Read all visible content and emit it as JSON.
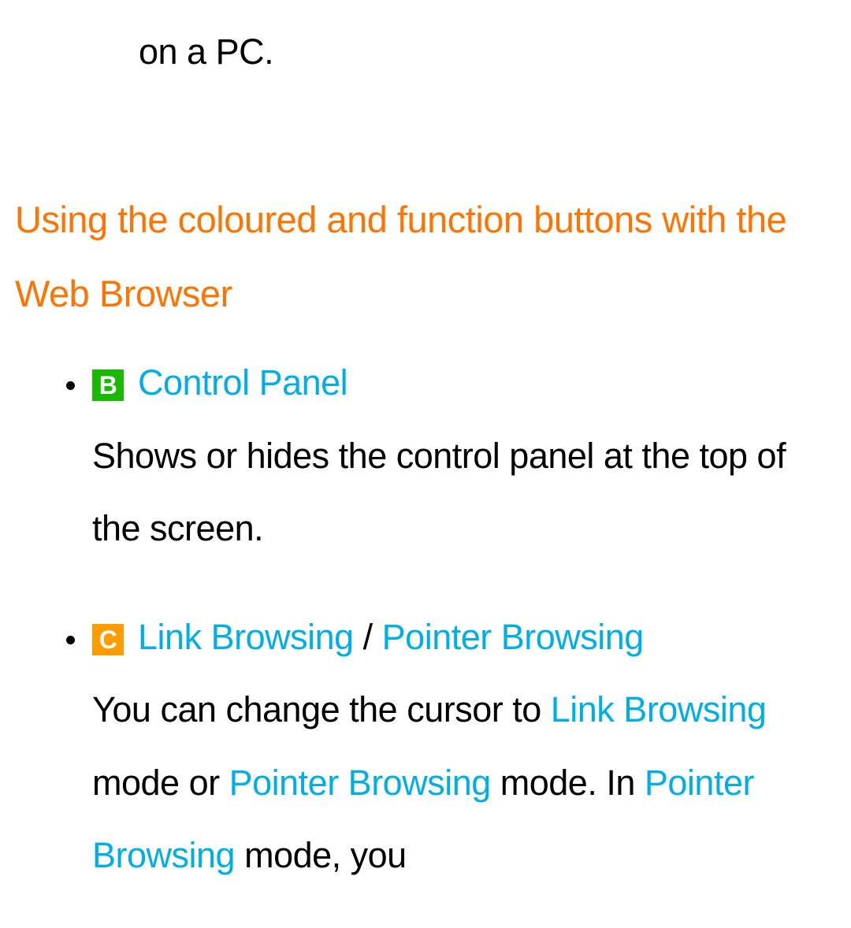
{
  "fragment_text": "on a PC.",
  "section_heading": "Using the coloured and function buttons with the Web Browser",
  "items": [
    {
      "badge_letter": "B",
      "title": "Control Panel",
      "desc": "Shows or hides the control panel at the top of the screen."
    },
    {
      "badge_letter": "C",
      "title_a": "Link Browsing",
      "slash": " / ",
      "title_b": "Pointer Browsing",
      "desc_parts": {
        "p1": "You can change the cursor to ",
        "t1": "Link Browsing",
        "p2": " mode or ",
        "t2": "Pointer Browsing",
        "p3": " mode. In ",
        "t3": "Pointer Browsing",
        "p4": " mode, you"
      }
    }
  ]
}
